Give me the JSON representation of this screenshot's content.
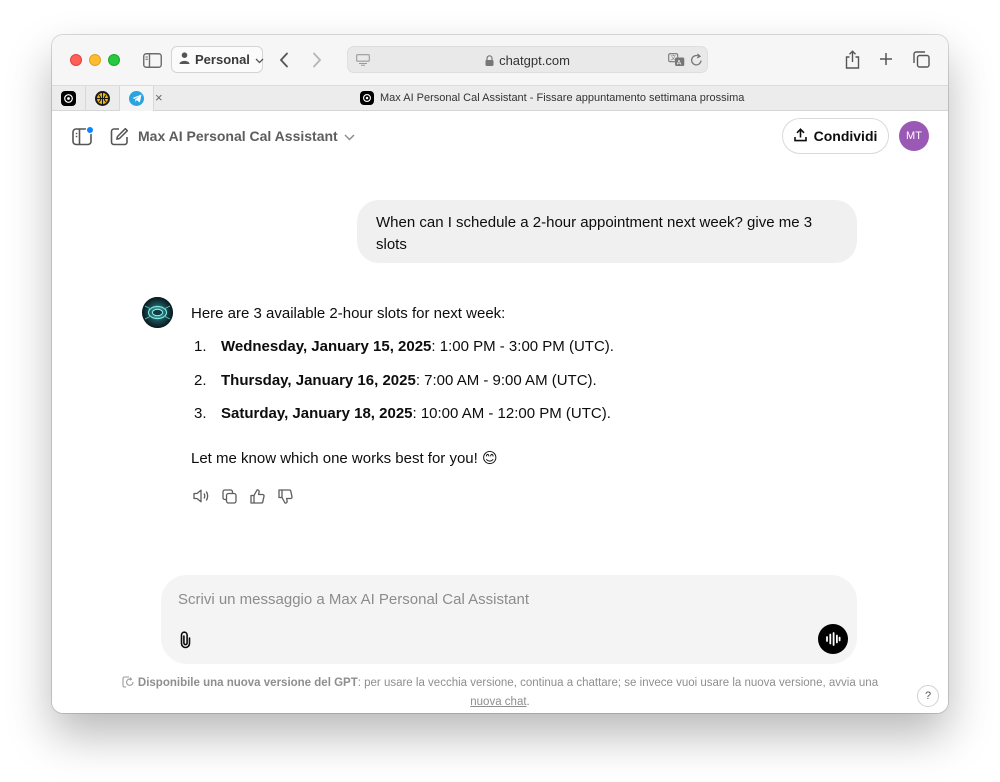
{
  "browser": {
    "profile_label": "Personal",
    "url": "chatgpt.com",
    "tab_title": "Max AI Personal Cal Assistant - Fissare appuntamento settimana prossima",
    "tab_close": "×"
  },
  "header": {
    "gpt_name": "Max AI Personal Cal Assistant",
    "share_label": "Condividi",
    "avatar_initials": "MT"
  },
  "conversation": {
    "user_message": "When can I schedule a 2-hour appointment next week? give me 3 slots",
    "assistant_intro": "Here are 3 available 2-hour slots for next week:",
    "slots": [
      {
        "num": "1.",
        "date": "Wednesday, January 15, 2025",
        "time": ": 1:00 PM - 3:00 PM (UTC)."
      },
      {
        "num": "2.",
        "date": "Thursday, January 16, 2025",
        "time": ": 7:00 AM - 9:00 AM (UTC)."
      },
      {
        "num": "3.",
        "date": "Saturday, January 18, 2025",
        "time": ": 10:00 AM - 12:00 PM (UTC)."
      }
    ],
    "assistant_closing": "Let me know which one works best for you! 😊"
  },
  "composer": {
    "placeholder": "Scrivi un messaggio a Max AI Personal Cal Assistant"
  },
  "notice": {
    "bold": "Disponibile una nuova versione del GPT",
    "text": ": per usare la vecchia versione, continua a chattare; se invece vuoi usare la nuova versione, avvia una ",
    "link": "nuova chat",
    "end": "."
  },
  "help_label": "?",
  "colors": {
    "avatar": "#9b59b6",
    "user_bubble": "#f0f0f0",
    "composer": "#f4f4f4",
    "notification_dot": "#0a84ff"
  }
}
